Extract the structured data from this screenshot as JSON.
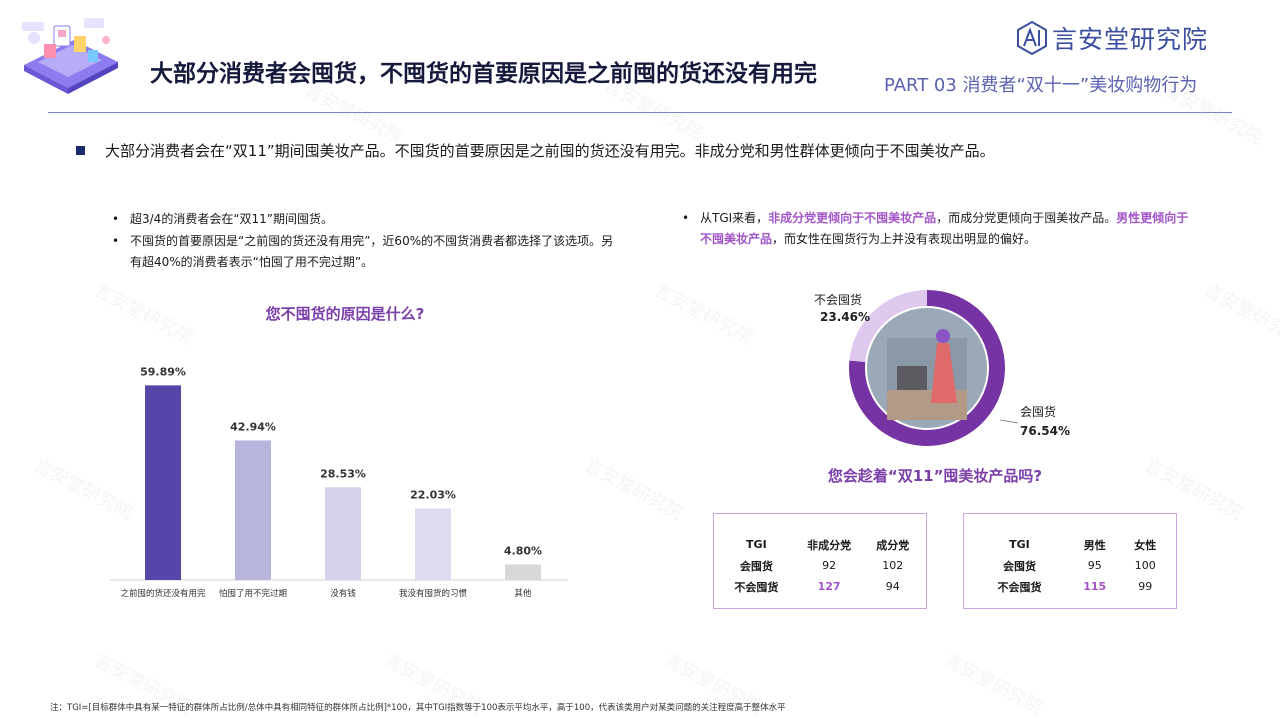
{
  "header": {
    "title": "大部分消费者会囤货，不囤货的首要原因是之前囤的货还没有用完",
    "logo_text": "言安堂研究院",
    "section_label": "PART 03 消费者“双十一”美妆购物行为"
  },
  "summary": "大部分消费者会在“双11”期间囤美妆产品。不囤货的首要原因是之前囤的货还没有用完。非成分党和男性群体更倾向于不囤美妆产品。",
  "left_bullets": [
    "超3/4的消费者会在“双11”期间囤货。",
    "不囤货的首要原因是“之前囤的货还没有用完”，近60%的不囤货消费者都选择了该选项。另有超40%的消费者表示“怕囤了用不完过期”。"
  ],
  "right_bullet": {
    "p1": "从TGI来看，",
    "h1": "非成分党更倾向于不囤美妆产品",
    "p2": "，而成分党更倾向于囤美妆产品。",
    "h2": "男性更倾向于不囤美妆产品",
    "p3": "，而女性在囤货行为上并没有表现出明显的偏好。"
  },
  "chart_data": [
    {
      "type": "bar",
      "title": "您不囤货的原因是什么?",
      "categories": [
        "之前囤的货还没有用完",
        "怕囤了用不完过期",
        "没有钱",
        "我没有囤货的习惯",
        "其他"
      ],
      "values": [
        59.89,
        42.94,
        28.53,
        22.03,
        4.8
      ],
      "value_labels": [
        "59.89%",
        "42.94%",
        "28.53%",
        "22.03%",
        "4.80%"
      ],
      "colors": [
        "#5447a9",
        "#b8b5dd",
        "#d3d1eb",
        "#dddcef",
        "#d8d8d8"
      ],
      "ylim": [
        0,
        60
      ]
    },
    {
      "type": "pie",
      "title": "您会趁着“双11”囤美妆产品吗?",
      "labels": [
        "会囤货",
        "不会囤货"
      ],
      "values": [
        76.54,
        23.46
      ],
      "value_labels": [
        "76.54%",
        "23.46%"
      ],
      "colors": [
        "#7533a3",
        "#e0c9ef"
      ]
    }
  ],
  "tgi_tables": [
    {
      "headers": [
        "TGI",
        "非成分党",
        "成分党"
      ],
      "rows": [
        [
          "会囤货",
          "92",
          "102"
        ],
        [
          "不会囤货",
          "127",
          "94"
        ]
      ]
    },
    {
      "headers": [
        "TGI",
        "男性",
        "女性"
      ],
      "rows": [
        [
          "会囤货",
          "95",
          "100"
        ],
        [
          "不会囤货",
          "115",
          "99"
        ]
      ]
    }
  ],
  "footnote": "注：TGI=[目标群体中具有某一特征的群体所占比例/总体中具有相同特征的群体所占比例]*100，其中TGI指数等于100表示平均水平，高于100，代表该类用户对某类问题的关注程度高于整体水平",
  "watermark_text": "言安堂研究院",
  "colors": {
    "title": "#151a3d",
    "accent_purple": "#7b3fa8",
    "highlight": "#a255c8",
    "logo_blue": "#3c4ea1"
  }
}
